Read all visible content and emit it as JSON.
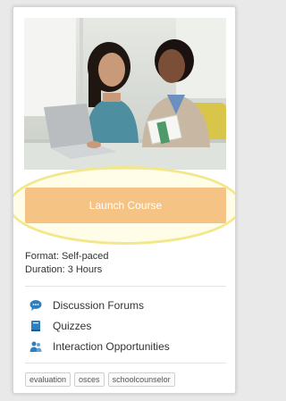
{
  "course": {
    "launch_label": "Launch Course",
    "format": "Format: Self-paced",
    "duration": "Duration: 3 Hours"
  },
  "features": [
    {
      "label": "Discussion Forums",
      "icon": "chat-bubble-icon"
    },
    {
      "label": "Quizzes",
      "icon": "book-icon"
    },
    {
      "label": "Interaction Opportunities",
      "icon": "people-icon"
    }
  ],
  "tags": [
    "evaluation",
    "osces",
    "schoolcounselor"
  ],
  "colors": {
    "accent": "#f5c484",
    "icon": "#2f7fbf",
    "highlight_ring": "#f2e78a"
  }
}
